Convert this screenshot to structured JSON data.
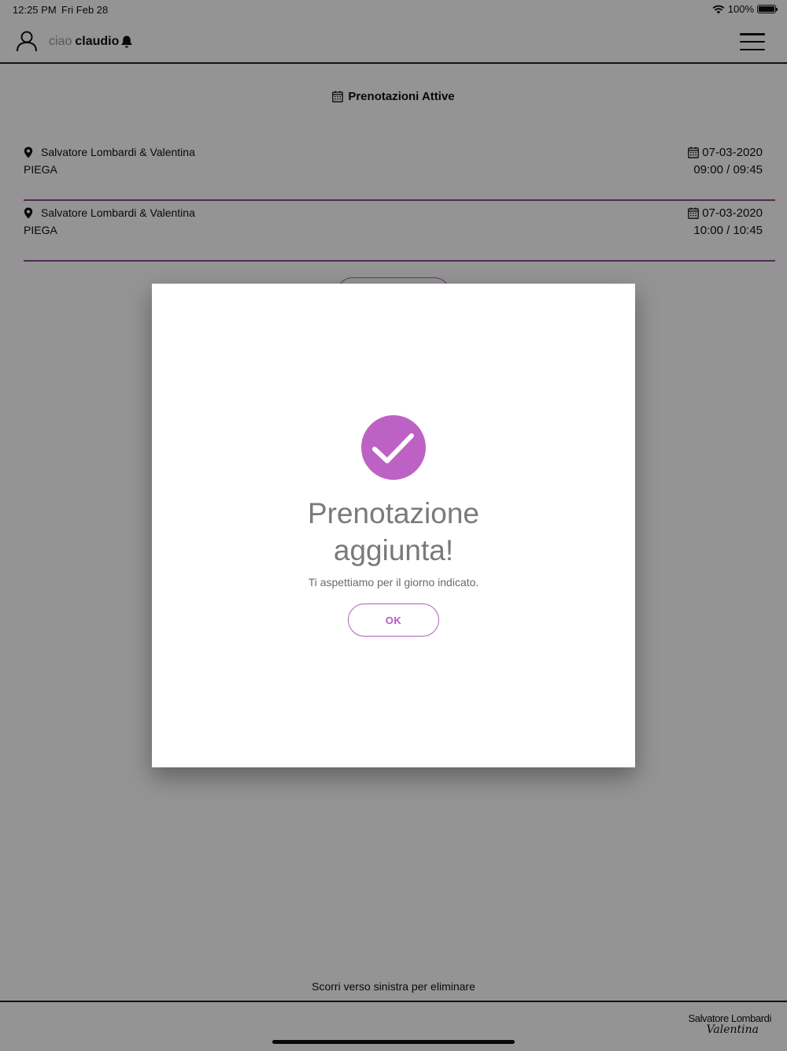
{
  "status_bar": {
    "time": "12:25 PM",
    "date": "Fri Feb 28",
    "battery": "100%"
  },
  "header": {
    "greeting": "ciao",
    "username": "claudio"
  },
  "section": {
    "title": "Prenotazioni Attive"
  },
  "bookings": [
    {
      "location": "Salvatore Lombardi & Valentina",
      "service": "PIEGA",
      "date": "07-03-2020",
      "time": "09:00 / 09:45"
    },
    {
      "location": "Salvatore Lombardi & Valentina",
      "service": "PIEGA",
      "date": "07-03-2020",
      "time": "10:00 / 10:45"
    }
  ],
  "footer": {
    "hint": "Scorri verso sinistra per eliminare",
    "logo_line1": "Salvatore Lombardi",
    "logo_line2": "Valentina"
  },
  "modal": {
    "icon": "check-circle-icon",
    "title_line1": "Prenotazione",
    "title_line2": "aggiunta!",
    "message": "Ti aspettiamo per il giorno indicato.",
    "ok_label": "OK"
  },
  "colors": {
    "accent": "#b35cbf",
    "divider": "#8a4a94",
    "overlay": "rgba(0,0,0,0.42)"
  }
}
